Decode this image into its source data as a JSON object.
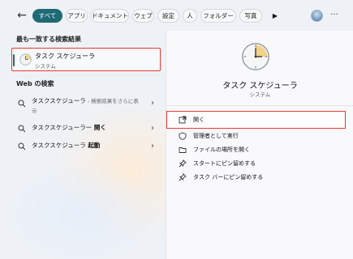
{
  "filters": {
    "all": "すべて",
    "apps": "アプリ",
    "documents": "ドキュメント",
    "web": "ウェブ",
    "settings": "設定",
    "people": "人",
    "folders": "フォルダー",
    "photos": "写真"
  },
  "best_match": {
    "heading": "最も一致する検索結果",
    "name": "タスク スケジューラ",
    "type": "システム"
  },
  "web_search": {
    "heading": "Web の検索",
    "results": [
      {
        "query": "タスクスケジューラ",
        "suffix": " - 検索結果をさらに表示"
      },
      {
        "query": "タスクスケジューラー",
        "suffix": " 開く"
      },
      {
        "query": "タスクスケジューラ",
        "suffix": " 起動"
      }
    ]
  },
  "detail": {
    "title": "タスク スケジューラ",
    "subtitle": "システム",
    "actions": {
      "open": "開く",
      "run_as_admin": "管理者として実行",
      "open_file_location": "ファイルの場所を開く",
      "pin_start": "スタートにピン留めする",
      "pin_taskbar": "タスク バーにピン留めする"
    }
  },
  "colors": {
    "accent": "#1e6a76",
    "highlight": "#e53935"
  }
}
